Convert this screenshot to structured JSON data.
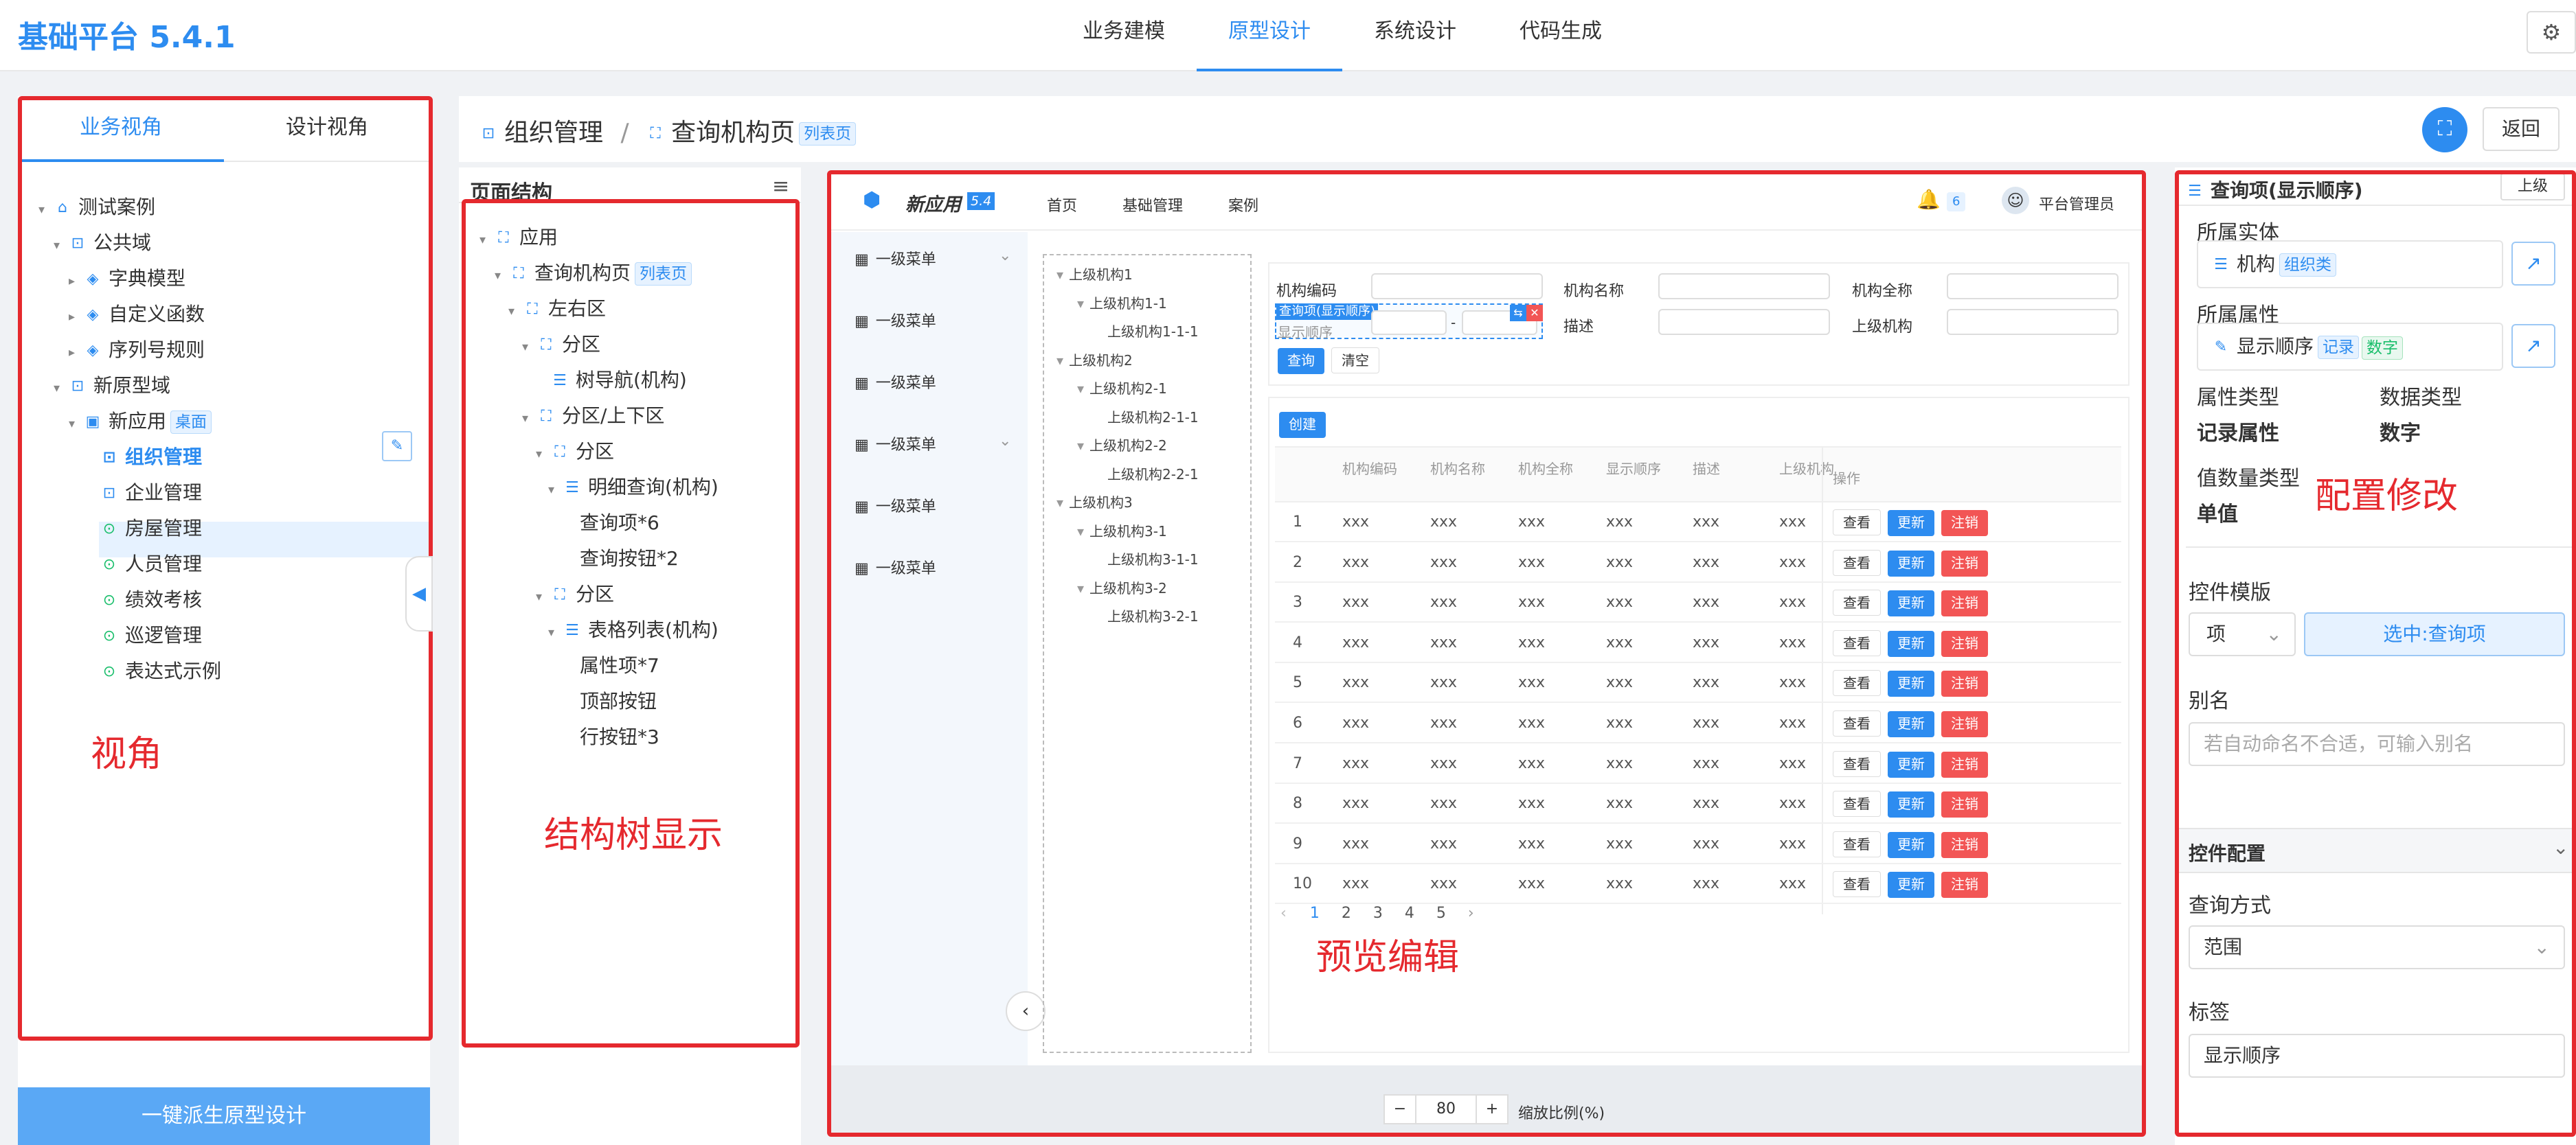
{
  "app": {
    "title": "基础平台 5.4.1",
    "tabs": [
      "业务建模",
      "原型设计",
      "系统设计",
      "代码生成"
    ],
    "active_tab": 1
  },
  "colors": {
    "accent": "#2d8cf0",
    "annotation": "#e5292e",
    "danger": "#f25555",
    "sidebar_bg": "#f3f7fc"
  },
  "left": {
    "tabs": [
      "业务视角",
      "设计视角"
    ],
    "tree": [
      {
        "label": "测试案例",
        "icon": "home-icon",
        "level": 0
      },
      {
        "label": "公共域",
        "icon": "domain-icon",
        "level": 1
      },
      {
        "label": "字典模型",
        "icon": "layers-icon",
        "level": 2
      },
      {
        "label": "自定义函数",
        "icon": "layers-icon",
        "level": 2
      },
      {
        "label": "序列号规则",
        "icon": "layers-icon",
        "level": 2
      },
      {
        "label": "新原型域",
        "icon": "domain-icon",
        "level": 1
      },
      {
        "label": "新应用",
        "icon": "app-icon",
        "level": 2,
        "tag": "桌面"
      },
      {
        "label": "组织管理",
        "icon": "domain-icon",
        "level": 3,
        "selected": true
      },
      {
        "label": "企业管理",
        "icon": "domain-icon",
        "level": 3
      },
      {
        "label": "房屋管理",
        "icon": "search-icon",
        "level": 3
      },
      {
        "label": "人员管理",
        "icon": "search-icon",
        "level": 3
      },
      {
        "label": "绩效考核",
        "icon": "search-icon",
        "level": 3
      },
      {
        "label": "巡逻管理",
        "icon": "search-icon",
        "level": 3
      },
      {
        "label": "表达式示例",
        "icon": "search-icon",
        "level": 3
      }
    ],
    "derive_button": "一键派生原型设计",
    "annotation": "视角"
  },
  "breadcrumb": {
    "first": "组织管理",
    "second": "查询机构页",
    "tag": "列表页",
    "back": "返回"
  },
  "structure": {
    "title": "页面结构",
    "annotation": "结构树显示",
    "tree": [
      {
        "label": "应用",
        "level": 0
      },
      {
        "label": "查询机构页",
        "level": 1,
        "tag": "列表页"
      },
      {
        "label": "左右区",
        "level": 2
      },
      {
        "label": "分区",
        "level": 3
      },
      {
        "label": "树导航(机构)",
        "level": 4,
        "leaf": true
      },
      {
        "label": "分区/上下区",
        "level": 3
      },
      {
        "label": "分区",
        "level": 4
      },
      {
        "label": "明细查询(机构)",
        "level": 5
      },
      {
        "label": "查询项*6",
        "level": 6,
        "muted": true
      },
      {
        "label": "查询按钮*2",
        "level": 6,
        "muted": true
      },
      {
        "label": "分区",
        "level": 4
      },
      {
        "label": "表格列表(机构)",
        "level": 5
      },
      {
        "label": "属性项*7",
        "level": 6,
        "muted": true
      },
      {
        "label": "顶部按钮",
        "level": 6,
        "muted": true
      },
      {
        "label": "行按钮*3",
        "level": 6,
        "muted": true
      }
    ]
  },
  "preview": {
    "app_name": "新应用",
    "version": "5.4",
    "nav": [
      "首页",
      "基础管理",
      "案例"
    ],
    "bell_count": "6",
    "user": "平台管理员",
    "menus": [
      "一级菜单",
      "一级菜单",
      "一级菜单",
      "一级菜单",
      "一级菜单",
      "一级菜单"
    ],
    "org_tree": [
      {
        "label": "上级机构1",
        "level": 0
      },
      {
        "label": "上级机构1-1",
        "level": 1
      },
      {
        "label": "上级机构1-1-1",
        "level": 2
      },
      {
        "label": "上级机构2",
        "level": 0
      },
      {
        "label": "上级机构2-1",
        "level": 1
      },
      {
        "label": "上级机构2-1-1",
        "level": 2
      },
      {
        "label": "上级机构2-2",
        "level": 1
      },
      {
        "label": "上级机构2-2-1",
        "level": 2
      },
      {
        "label": "上级机构3",
        "level": 0
      },
      {
        "label": "上级机构3-1",
        "level": 1
      },
      {
        "label": "上级机构3-1-1",
        "level": 2
      },
      {
        "label": "上级机构3-2",
        "level": 1
      },
      {
        "label": "上级机构3-2-1",
        "level": 2
      }
    ],
    "query": {
      "fields": [
        "机构编码",
        "机构名称",
        "机构全称",
        "显示顺序",
        "描述",
        "上级机构"
      ],
      "selected_hint": "查询项(显示顺序)",
      "range_sep": "-",
      "query_btn": "查询",
      "clear_btn": "清空"
    },
    "create_btn": "创建",
    "columns": [
      "机构编码",
      "机构名称",
      "机构全称",
      "显示顺序",
      "描述",
      "上级机构",
      "操作"
    ],
    "rows": [
      "1",
      "2",
      "3",
      "4",
      "5",
      "6",
      "7",
      "8",
      "9",
      "10"
    ],
    "cell": "xxx",
    "row_buttons": [
      "查看",
      "更新",
      "注销"
    ],
    "pages": [
      "1",
      "2",
      "3",
      "4",
      "5"
    ],
    "zoom": "80",
    "zoom_label": "缩放比例(%)",
    "annotation": "预览编辑"
  },
  "props": {
    "title": "查询项(显示顺序)",
    "up": "上级",
    "entity_label": "所属实体",
    "entity": "机构",
    "entity_tag": "组织类",
    "attr_label": "所属属性",
    "attr": "显示顺序",
    "attr_tag1": "记录",
    "attr_tag2": "数字",
    "attr_type_label": "属性类型",
    "attr_type": "记录属性",
    "data_type_label": "数据类型",
    "data_type": "数字",
    "value_type_label": "值数量类型",
    "value_type": "单值",
    "template_label": "控件模版",
    "template_select": "项",
    "template_btn": "选中:查询项",
    "alias_label": "别名",
    "alias_placeholder": "若自动命名不合适，可输入别名",
    "config_title": "控件配置",
    "query_mode_label": "查询方式",
    "query_mode": "范围",
    "tag_label": "标签",
    "tag_value": "显示顺序",
    "annotation": "配置修改"
  }
}
